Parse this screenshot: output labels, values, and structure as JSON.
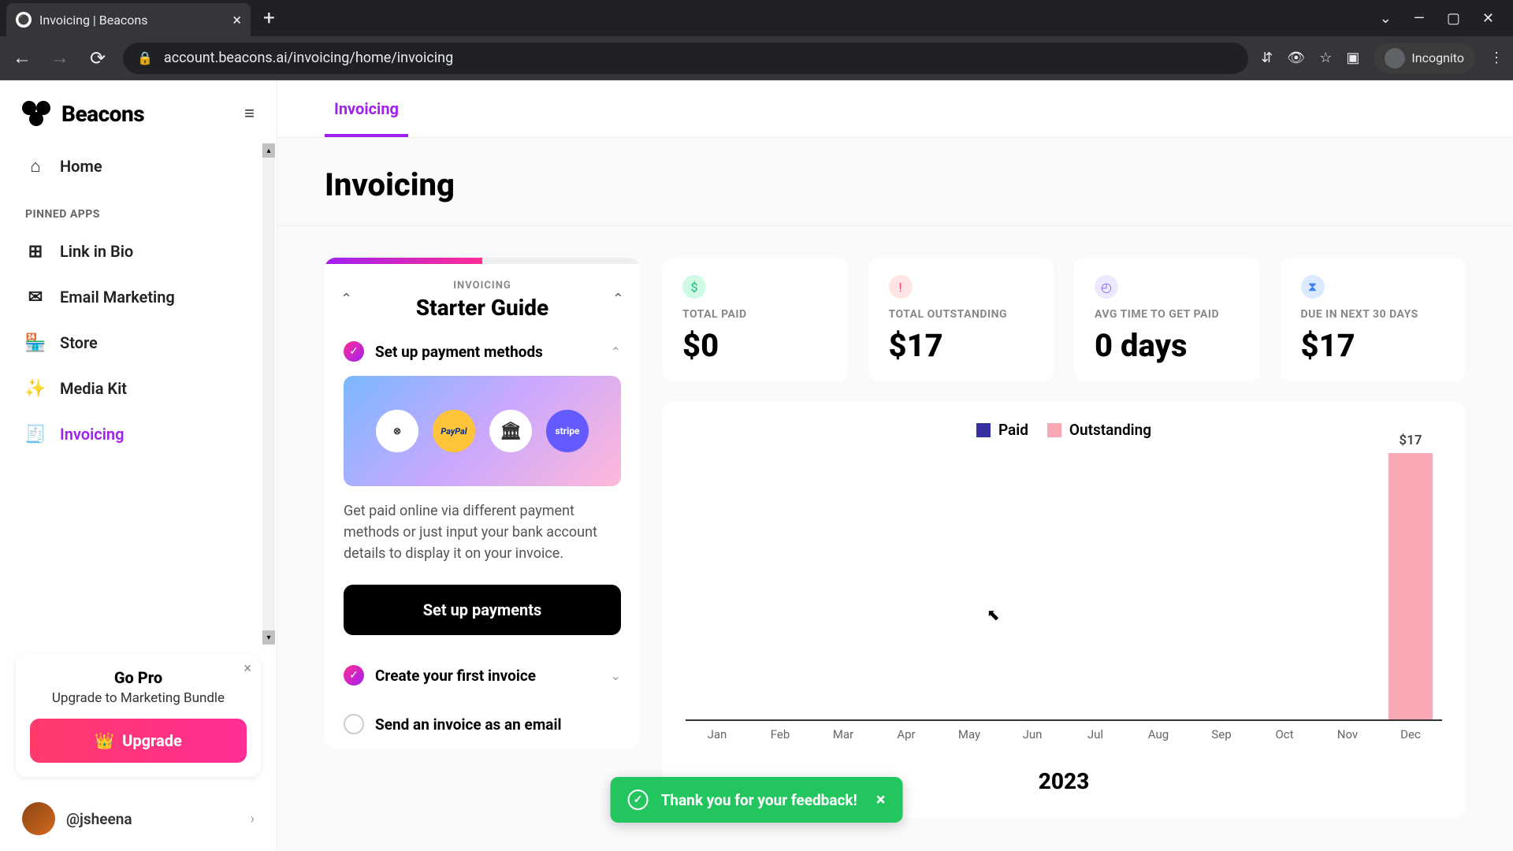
{
  "browser": {
    "tab_title": "Invoicing | Beacons",
    "url": "account.beacons.ai/invoicing/home/invoicing",
    "incognito_label": "Incognito"
  },
  "sidebar": {
    "brand": "Beacons",
    "items": [
      {
        "label": "Home",
        "icon": "home"
      },
      {
        "label": "Link in Bio",
        "icon": "grid"
      },
      {
        "label": "Email Marketing",
        "icon": "mail"
      },
      {
        "label": "Store",
        "icon": "store"
      },
      {
        "label": "Media Kit",
        "icon": "sparkle"
      },
      {
        "label": "Invoicing",
        "icon": "invoice",
        "active": true
      }
    ],
    "section_label": "PINNED APPS",
    "go_pro": {
      "title": "Go Pro",
      "subtitle": "Upgrade to Marketing Bundle",
      "button": "Upgrade"
    },
    "user_handle": "@jsheena"
  },
  "main": {
    "tab": "Invoicing",
    "title": "Invoicing",
    "starter": {
      "eyebrow": "INVOICING",
      "title": "Starter Guide",
      "steps": [
        {
          "label": "Set up payment methods",
          "done": true,
          "expanded": true
        },
        {
          "label": "Create your first invoice",
          "done": true,
          "expanded": false
        },
        {
          "label": "Send an invoice as an email",
          "done": false,
          "expanded": false
        }
      ],
      "description": "Get paid online via different payment methods or just input your bank account details to display it on your invoice.",
      "cta": "Set up payments",
      "payment_icons": [
        "venmo",
        "PayPal",
        "bank",
        "stripe"
      ]
    },
    "stats": [
      {
        "label": "TOTAL PAID",
        "value": "$0",
        "icon": "dollar",
        "color": "green"
      },
      {
        "label": "TOTAL OUTSTANDING",
        "value": "$17",
        "icon": "alert",
        "color": "pink"
      },
      {
        "label": "AVG TIME TO GET PAID",
        "value": "0 days",
        "icon": "clock",
        "color": "purple"
      },
      {
        "label": "DUE IN NEXT 30 DAYS",
        "value": "$17",
        "icon": "hourglass",
        "color": "blue"
      }
    ],
    "chart_legend": {
      "paid": "Paid",
      "outstanding": "Outstanding"
    },
    "chart_year": "2023"
  },
  "toast": {
    "message": "Thank you for your feedback!"
  },
  "chart_data": {
    "type": "bar",
    "title": "",
    "xlabel": "2023",
    "ylabel": "",
    "categories": [
      "Jan",
      "Feb",
      "Mar",
      "Apr",
      "May",
      "Jun",
      "Jul",
      "Aug",
      "Sep",
      "Oct",
      "Nov",
      "Dec"
    ],
    "series": [
      {
        "name": "Paid",
        "values": [
          0,
          0,
          0,
          0,
          0,
          0,
          0,
          0,
          0,
          0,
          0,
          0
        ],
        "color": "#3730a3"
      },
      {
        "name": "Outstanding",
        "values": [
          0,
          0,
          0,
          0,
          0,
          0,
          0,
          0,
          0,
          0,
          0,
          17
        ],
        "color": "#f9a8b4"
      }
    ],
    "ylim": [
      0,
      17
    ],
    "data_labels": {
      "11": "$17"
    }
  }
}
